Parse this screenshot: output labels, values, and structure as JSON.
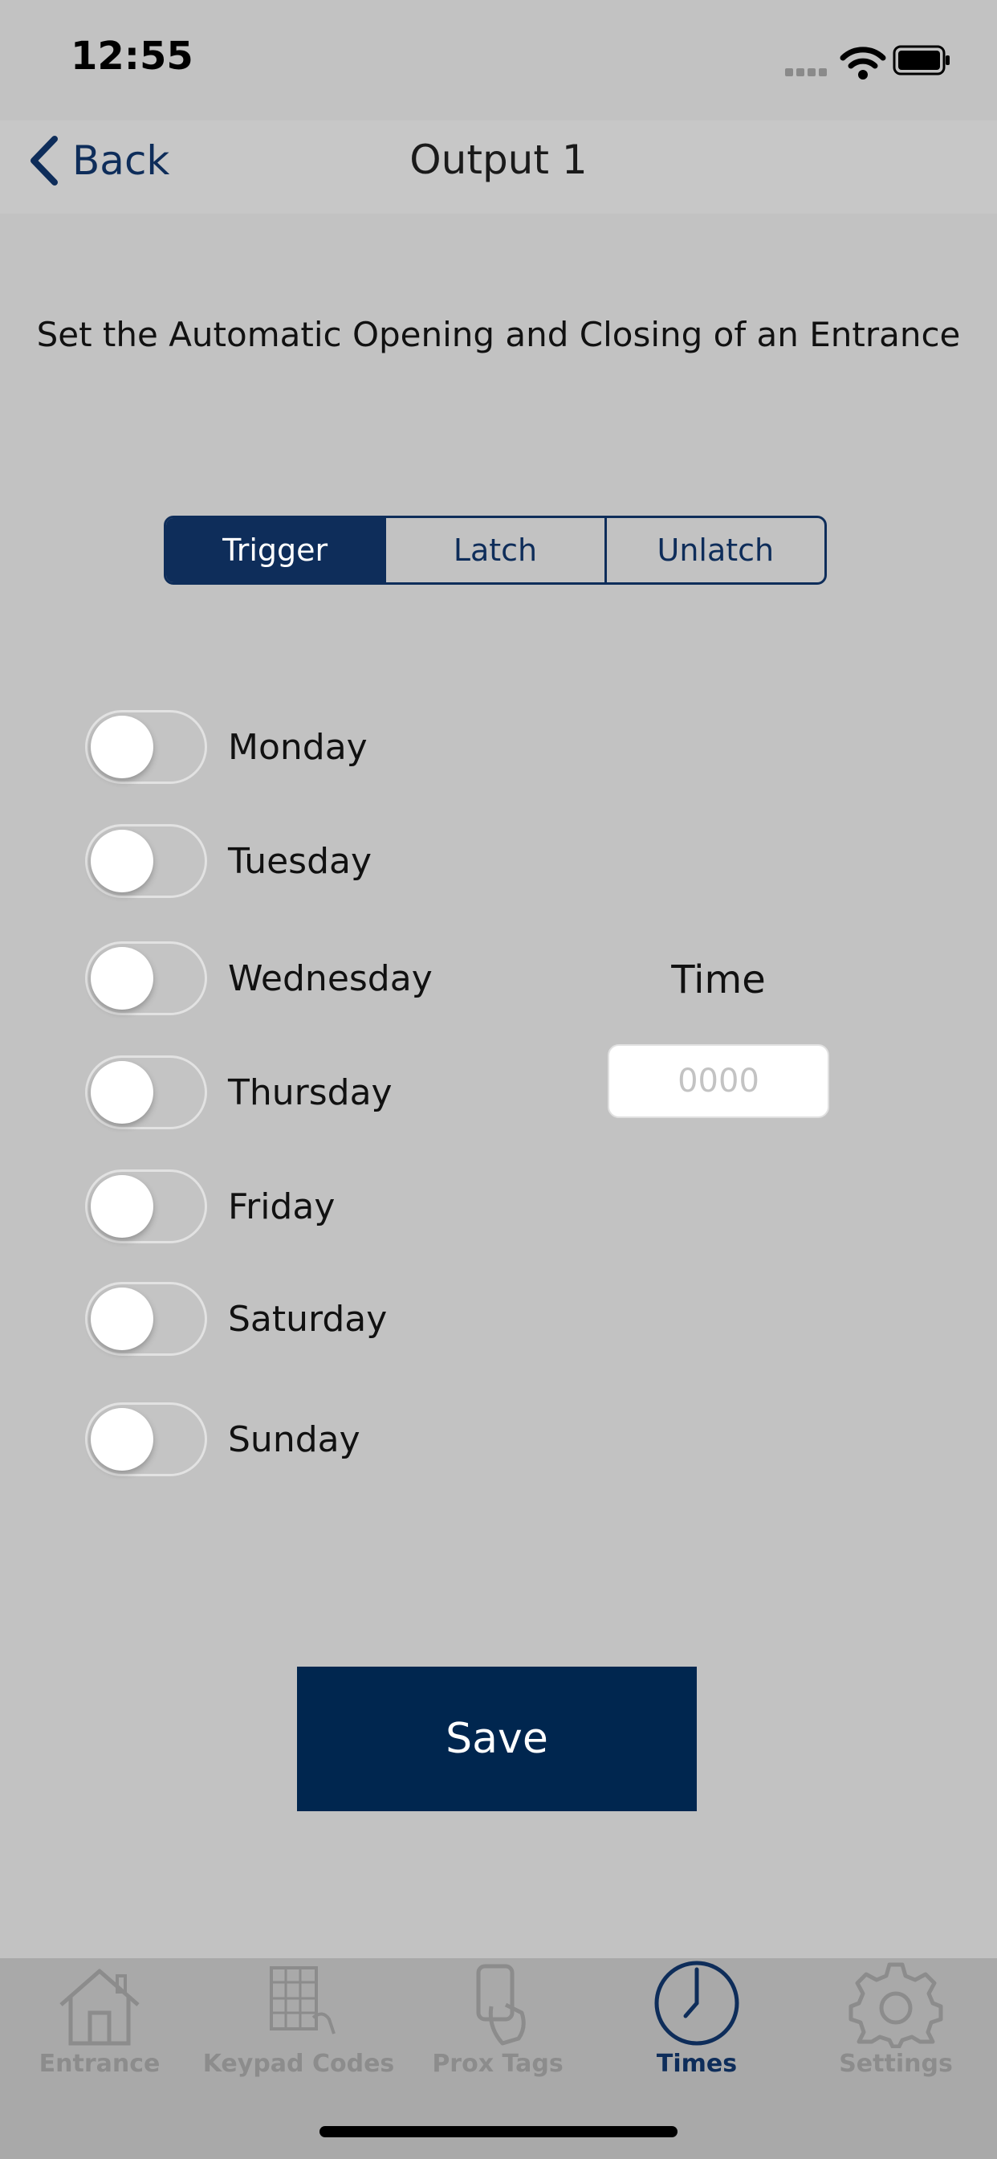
{
  "status_bar": {
    "time": "12:55"
  },
  "nav": {
    "back_label": "Back",
    "title": "Output 1"
  },
  "subtitle": "Set the Automatic Opening and Closing of an Entrance",
  "segments": [
    {
      "label": "Trigger",
      "selected": true
    },
    {
      "label": "Latch",
      "selected": false
    },
    {
      "label": "Unlatch",
      "selected": false
    }
  ],
  "days": [
    {
      "label": "Monday",
      "on": false
    },
    {
      "label": "Tuesday",
      "on": false
    },
    {
      "label": "Wednesday",
      "on": false
    },
    {
      "label": "Thursday",
      "on": false
    },
    {
      "label": "Friday",
      "on": false
    },
    {
      "label": "Saturday",
      "on": false
    },
    {
      "label": "Sunday",
      "on": false
    }
  ],
  "time": {
    "label": "Time",
    "value": "",
    "placeholder": "0000"
  },
  "save_label": "Save",
  "tabs": [
    {
      "label": "Entrance",
      "icon": "house-icon",
      "active": false
    },
    {
      "label": "Keypad Codes",
      "icon": "keypad-icon",
      "active": false
    },
    {
      "label": "Prox Tags",
      "icon": "prox-tag-icon",
      "active": false
    },
    {
      "label": "Times",
      "icon": "clock-icon",
      "active": true
    },
    {
      "label": "Settings",
      "icon": "gear-icon",
      "active": false
    }
  ],
  "colors": {
    "accent": "#0e2d5a",
    "save_button": "#00264f",
    "background": "#c2c2c2",
    "tab_bar": "#a9a9a9"
  }
}
